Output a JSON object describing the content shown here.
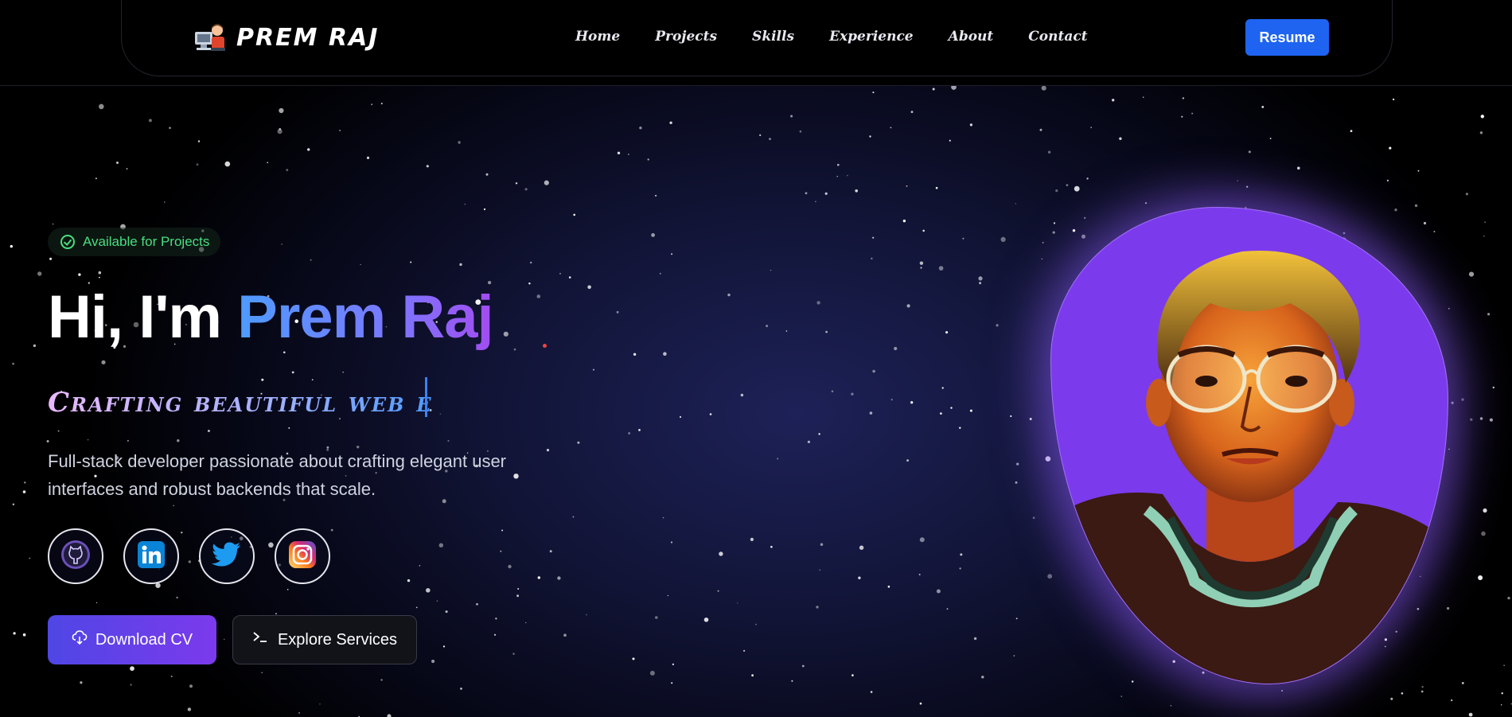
{
  "brand": {
    "name": "PREM RAJ",
    "logo_icon": "developer-at-computer-icon"
  },
  "nav": {
    "items": [
      {
        "label": "Home"
      },
      {
        "label": "Projects"
      },
      {
        "label": "Skills"
      },
      {
        "label": "Experience"
      },
      {
        "label": "About"
      },
      {
        "label": "Contact"
      }
    ],
    "resume_label": "Resume"
  },
  "hero": {
    "badge": {
      "label": "Available for Projects",
      "icon": "check-circle-icon",
      "color": "#4ade80"
    },
    "greeting": "Hi, I'm",
    "name": "Prem Raj",
    "tagline_typed": "Crafting beautiful web e",
    "description": "Full-stack developer passionate about crafting elegant user interfaces and robust backends that scale.",
    "socials": [
      {
        "name": "github-icon"
      },
      {
        "name": "linkedin-icon"
      },
      {
        "name": "twitter-icon"
      },
      {
        "name": "instagram-icon"
      }
    ],
    "download_label": "Download CV",
    "download_icon": "cloud-download-icon",
    "explore_label": "Explore Services",
    "explore_icon": "terminal-icon"
  },
  "colors": {
    "accent_blue": "#1e64f0",
    "accent_purple": "#7c3aed",
    "name_gradient_start": "#4d9bff",
    "name_gradient_end": "#a24cf0",
    "badge_green": "#4ade80"
  }
}
